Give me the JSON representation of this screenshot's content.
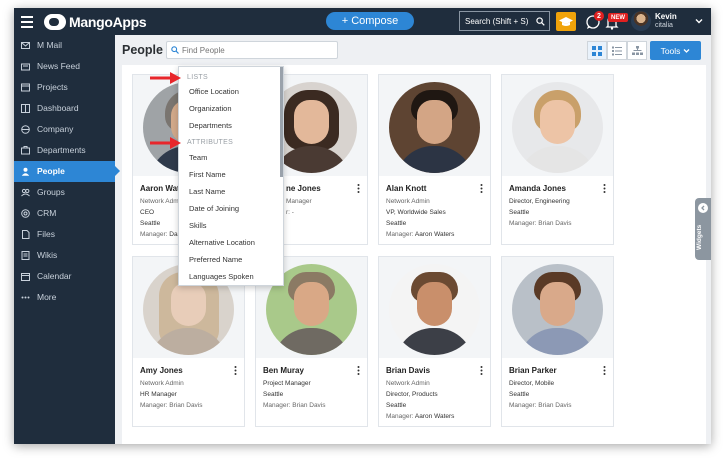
{
  "app": {
    "logo_text": "MangoApps"
  },
  "topbar": {
    "compose_label": "+ Compose",
    "search_label": "Search (Shift + S)",
    "chat_badge": "2",
    "new_badge": "NEW",
    "user_name": "Kevin",
    "user_sub": "citalia"
  },
  "sidebar": {
    "items": [
      {
        "label": "M Mail",
        "icon": "mail-icon"
      },
      {
        "label": "News Feed",
        "icon": "newsfeed-icon"
      },
      {
        "label": "Projects",
        "icon": "projects-icon"
      },
      {
        "label": "Dashboard",
        "icon": "dashboard-icon"
      },
      {
        "label": "Company",
        "icon": "company-icon"
      },
      {
        "label": "Departments",
        "icon": "departments-icon"
      },
      {
        "label": "People",
        "icon": "people-icon"
      },
      {
        "label": "Groups",
        "icon": "groups-icon"
      },
      {
        "label": "CRM",
        "icon": "crm-icon"
      },
      {
        "label": "Files",
        "icon": "files-icon"
      },
      {
        "label": "Wikis",
        "icon": "wikis-icon"
      },
      {
        "label": "Calendar",
        "icon": "calendar-icon"
      },
      {
        "label": "More",
        "icon": "more-icon"
      }
    ],
    "active_index": 6
  },
  "main": {
    "title": "People",
    "find_placeholder": "Find People",
    "tools_label": "Tools"
  },
  "dropdown": {
    "lists_heading": "LISTS",
    "lists": [
      "Office Location",
      "Organization",
      "Departments"
    ],
    "attributes_heading": "ATTRIBUTES",
    "attributes": [
      "Team",
      "First Name",
      "Last Name",
      "Date of Joining",
      "Skills",
      "Alternative Location",
      "Preferred Name",
      "Languages Spoken"
    ]
  },
  "people": [
    {
      "name": "Aaron Wate",
      "role": "Network Admin",
      "title": "CEO",
      "location": "Seattle",
      "manager_prefix": "Manager:",
      "manager": "Dan"
    },
    {
      "name": "ne Jones",
      "role": "Manager",
      "title": "r: -",
      "location": "",
      "manager_prefix": "",
      "manager": ""
    },
    {
      "name": "Alan Knott",
      "role": "Network Admin",
      "title": "VP, Worldwide Sales",
      "location": "Seattle",
      "manager_prefix": "Manager:",
      "manager": "Aaron Waters"
    },
    {
      "name": "Amanda Jones",
      "role": "Director, Engineering",
      "title": "Seattle",
      "location": "Manager: Brian Davis",
      "manager_prefix": "",
      "manager": ""
    },
    {
      "name": "Amy Jones",
      "role": "Network Admin",
      "title": "HR Manager",
      "location": "Manager: Brian Davis",
      "manager_prefix": "",
      "manager": ""
    },
    {
      "name": "Ben Muray",
      "role": "Project Manager",
      "title": "Seattle",
      "location": "Manager: Brian Davis",
      "manager_prefix": "",
      "manager": ""
    },
    {
      "name": "Brian Davis",
      "role": "Network Admin",
      "title": "Director, Products",
      "location": "Seattle",
      "manager_prefix": "Manager:",
      "manager": "Aaron Waters"
    },
    {
      "name": "Brian Parker",
      "role": "Director, Mobile",
      "title": "Seattle",
      "location": "Manager: Brian Davis",
      "manager_prefix": "",
      "manager": ""
    }
  ],
  "widgets_label": "Widgets",
  "colors": {
    "topbar": "#1f2d3d",
    "accent": "#2d86d5",
    "badge": "#e02020",
    "arrow": "#e8262b",
    "cap": "#f0a30a"
  }
}
